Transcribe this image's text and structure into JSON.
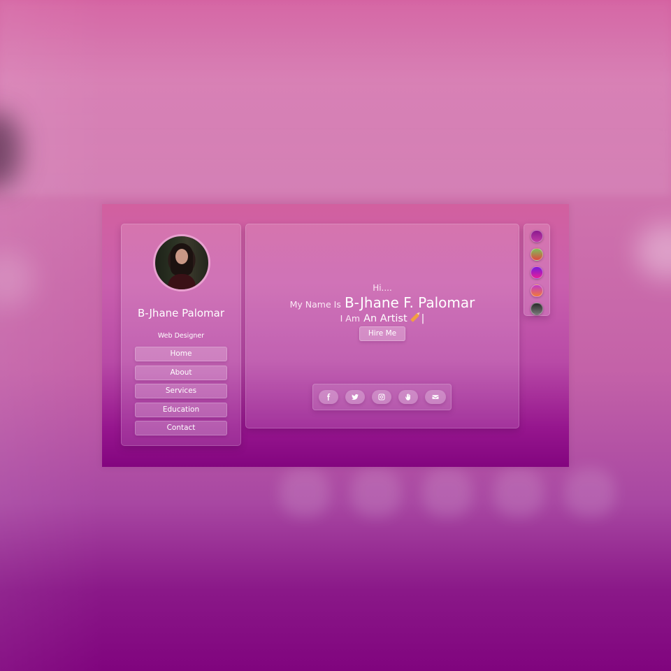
{
  "sidebar": {
    "name": "B-Jhane Palomar",
    "role": "Web Designer",
    "nav": [
      "Home",
      "About",
      "Services",
      "Education",
      "Contact"
    ]
  },
  "hero": {
    "greeting": "Hi....",
    "name_prefix": "My Name Is",
    "name": "B-Jhane F. Palomar",
    "role_prefix": "I Am",
    "role": "An Artist",
    "cursor": "|",
    "hire_label": "Hire Me"
  },
  "social": [
    "facebook-icon",
    "twitter-icon",
    "instagram-icon",
    "hand-icon",
    "envelope-icon"
  ],
  "palette": {
    "swatches": [
      [
        "#8b1a8e",
        "#c03aa6"
      ],
      [
        "#7fbf5a",
        "#e0473f"
      ],
      [
        "#7a1ad8",
        "#e61f9a"
      ],
      [
        "#c23ac8",
        "#f07a3a"
      ],
      [
        "#2a2a2a",
        "#777777"
      ]
    ]
  }
}
